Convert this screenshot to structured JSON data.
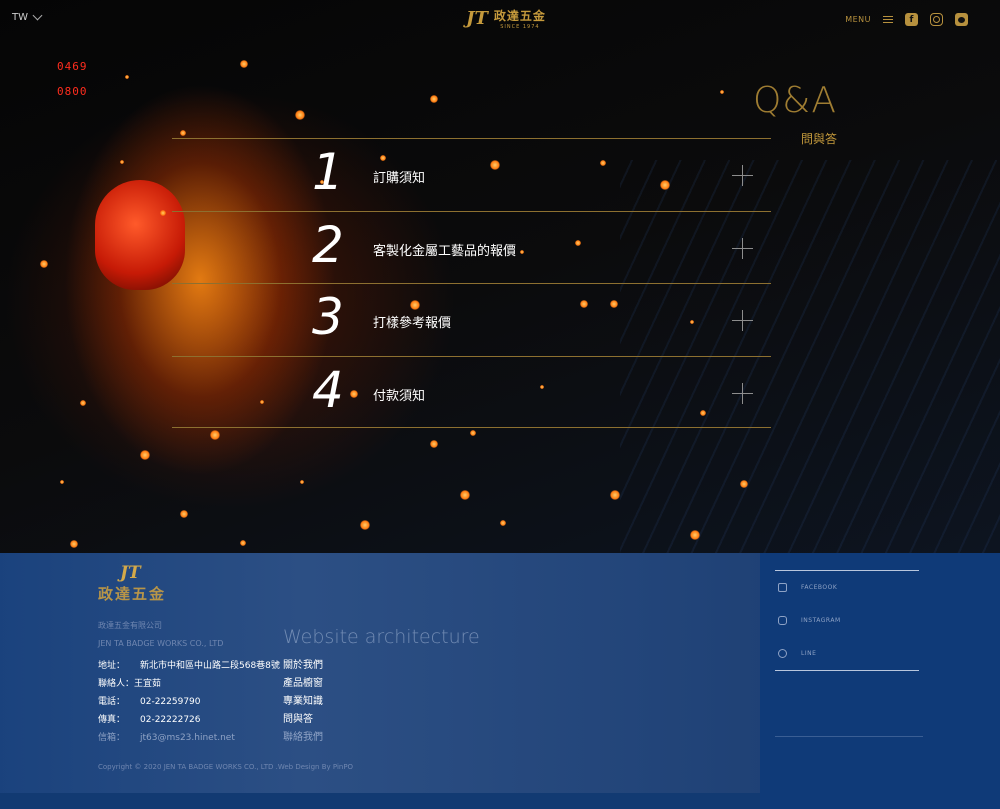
{
  "header": {
    "lang": "TW",
    "logo_mark": "JT",
    "logo_cn": "政達五金",
    "logo_since": "SINCE 1974",
    "menu_label": "MENU"
  },
  "hero": {
    "digital_top": "0469",
    "digital_bottom": "0800"
  },
  "qa": {
    "title": "Q&A",
    "subtitle": "問與答",
    "items": [
      {
        "num": "1",
        "label": "訂購須知"
      },
      {
        "num": "2",
        "label": "客製化金屬工藝品的報價"
      },
      {
        "num": "3",
        "label": "打樣參考報價"
      },
      {
        "num": "4",
        "label": "付款須知"
      }
    ]
  },
  "footer": {
    "logo_mark": "JT",
    "logo_cn": "政達五金",
    "company_cn": "政達五金有限公司",
    "company_en": "JEN TA BADGE WORKS CO., LTD",
    "address_key": "地址：",
    "address_val": "新北市中和區中山路二段568巷8號",
    "contact_key": "聯絡人：",
    "contact_val": "王宜茹",
    "phone_key": "電話：",
    "phone_val": "02-22259790",
    "fax_key": "傳真：",
    "fax_val": "02-22222726",
    "email_key": "信箱：",
    "email_val": "jt63@ms23.hinet.net",
    "arch_title": "Website architecture",
    "links": [
      "關於我們",
      "產品櫥窗",
      "專業知識",
      "問與答",
      "聯絡我們"
    ],
    "copyright": "Copyright © 2020 JEN TA BADGE WORKS CO., LTD .Web Design By PinPO",
    "social": [
      "FACEBOOK",
      "INSTAGRAM",
      "LINE"
    ]
  },
  "colors": {
    "gold": "#c59a3c",
    "footer_blue": "#123a72"
  }
}
